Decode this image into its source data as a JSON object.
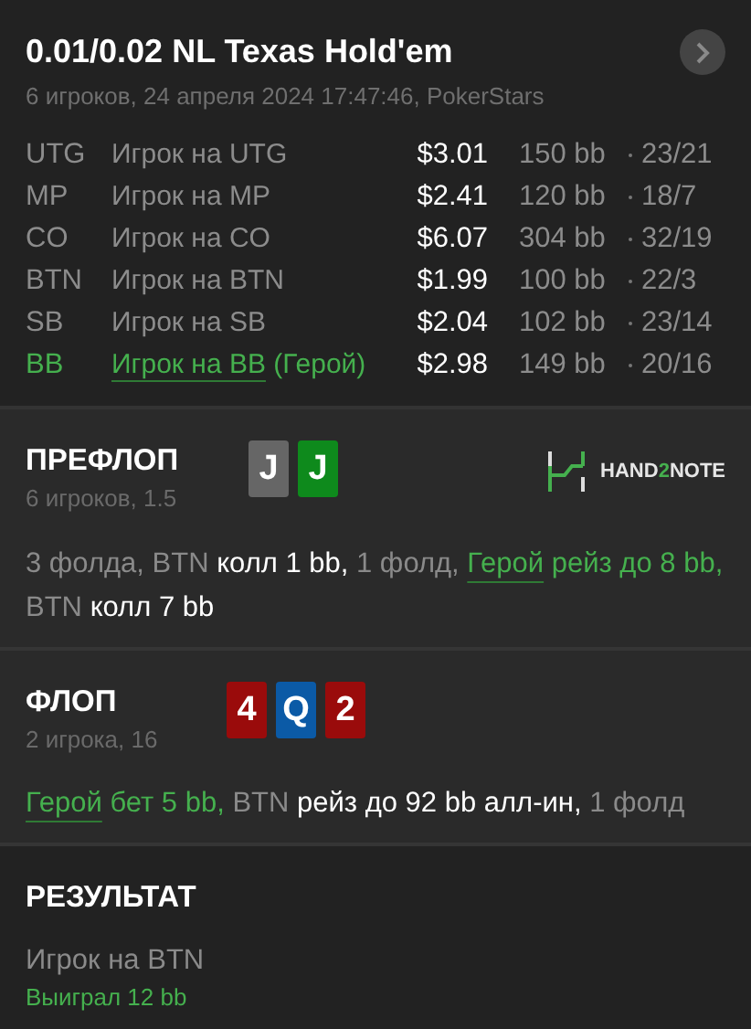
{
  "header": {
    "title": "0.01/0.02 NL Texas Hold'em",
    "subtitle": "6 игроков, 24 апреля 2024 17:47:46, PokerStars"
  },
  "players": [
    {
      "position": "UTG",
      "name": "Игрок на UTG",
      "hero": false,
      "stack": "$3.01",
      "bb": "150 bb",
      "stats": "23/21"
    },
    {
      "position": "MP",
      "name": "Игрок на MP",
      "hero": false,
      "stack": "$2.41",
      "bb": "120 bb",
      "stats": "18/7"
    },
    {
      "position": "CO",
      "name": "Игрок на CO",
      "hero": false,
      "stack": "$6.07",
      "bb": "304 bb",
      "stats": "32/19"
    },
    {
      "position": "BTN",
      "name": "Игрок на BTN",
      "hero": false,
      "stack": "$1.99",
      "bb": "100 bb",
      "stats": "22/3"
    },
    {
      "position": "SB",
      "name": "Игрок на SB",
      "hero": false,
      "stack": "$2.04",
      "bb": "102 bb",
      "stats": "23/14"
    },
    {
      "position": "BB",
      "name": "Игрок на BB",
      "hero": true,
      "tag": "(Герой)",
      "stack": "$2.98",
      "bb": "149 bb",
      "stats": "20/16"
    }
  ],
  "streets": [
    {
      "title": "ПРЕФЛОП",
      "subtitle": "6 игроков, 1.5",
      "cards": [
        {
          "rank": "J",
          "color": "#666666"
        },
        {
          "rank": "J",
          "color": "#0e8a1c"
        }
      ],
      "logo": [
        {
          "text": "HAND",
          "accent": false
        },
        {
          "text": "2",
          "accent": true
        },
        {
          "text": "NOTE",
          "accent": false
        }
      ],
      "actions": [
        {
          "text": "3 фолда, BTN ",
          "kind": "muted"
        },
        {
          "text": "колл 1 bb,",
          "kind": "strong"
        },
        {
          "text": " 1 фолд, ",
          "kind": "muted"
        },
        {
          "text": "Герой",
          "kind": "hero-link"
        },
        {
          "text": " рейз до 8 bb,",
          "kind": "hero"
        },
        {
          "text": " BTN ",
          "kind": "muted"
        },
        {
          "text": "колл 7 bb",
          "kind": "strong"
        }
      ]
    },
    {
      "title": "ФЛОП",
      "subtitle": "2 игрока, 16",
      "cards": [
        {
          "rank": "4",
          "color": "#9a0b0b"
        },
        {
          "rank": "Q",
          "color": "#0b5aa6"
        },
        {
          "rank": "2",
          "color": "#9a0b0b"
        }
      ],
      "actions": [
        {
          "text": "Герой",
          "kind": "hero-link"
        },
        {
          "text": " бет 5 bb,",
          "kind": "hero"
        },
        {
          "text": " BTN ",
          "kind": "muted"
        },
        {
          "text": "рейз до 92 bb алл-ин,",
          "kind": "strong"
        },
        {
          "text": " 1 фолд",
          "kind": "muted"
        }
      ]
    }
  ],
  "result": {
    "title": "РЕЗУЛЬТАТ",
    "player": "Игрок на BTN",
    "outcome": "Выиграл 12 bb"
  }
}
